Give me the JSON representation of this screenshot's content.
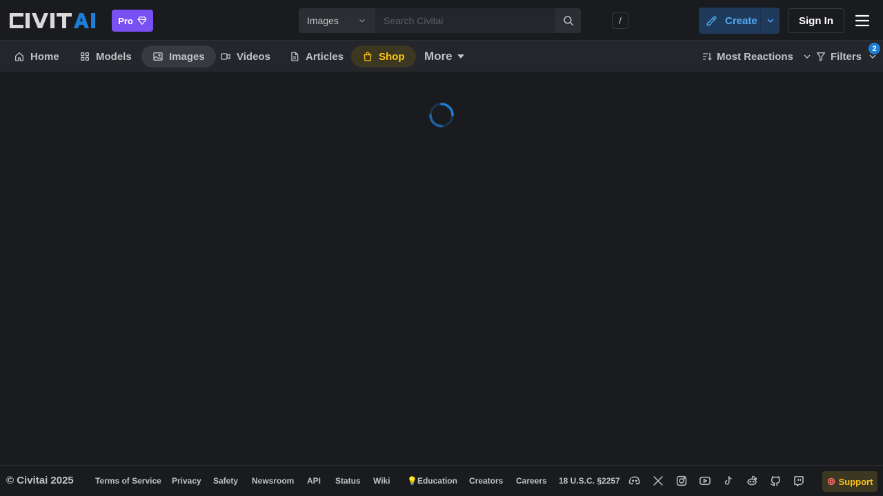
{
  "header": {
    "logo_text": "CIVITAI",
    "pro_label": "Pro",
    "search": {
      "scope": "Images",
      "placeholder": "Search Civitai",
      "shortcut": "/"
    },
    "create_label": "Create",
    "signin_label": "Sign In"
  },
  "nav": {
    "items": [
      {
        "label": "Home",
        "icon": "home-icon"
      },
      {
        "label": "Models",
        "icon": "grid-icon"
      },
      {
        "label": "Images",
        "icon": "image-icon"
      },
      {
        "label": "Videos",
        "icon": "video-icon"
      },
      {
        "label": "Articles",
        "icon": "file-icon"
      },
      {
        "label": "Shop",
        "icon": "shopping-bag-icon"
      }
    ],
    "active": "Images",
    "more_label": "More",
    "sort_label": "Most Reactions",
    "filters_label": "Filters",
    "filters_count": "2"
  },
  "footer": {
    "copyright": "© Civitai 2025",
    "links": [
      "Terms of Service",
      "Privacy",
      "Safety",
      "Newsroom",
      "API",
      "Status",
      "Wiki",
      "Education",
      "Creators",
      "Careers",
      "18 U.S.C. §2257"
    ],
    "support_label": "Support"
  },
  "colors": {
    "background": "#1a1b1e",
    "nav_background": "#25262b",
    "pro": "#7950f2",
    "accent_blue": "#4dabf7",
    "shop_yellow": "#fcc419",
    "badge_blue": "#1c7ed6"
  }
}
